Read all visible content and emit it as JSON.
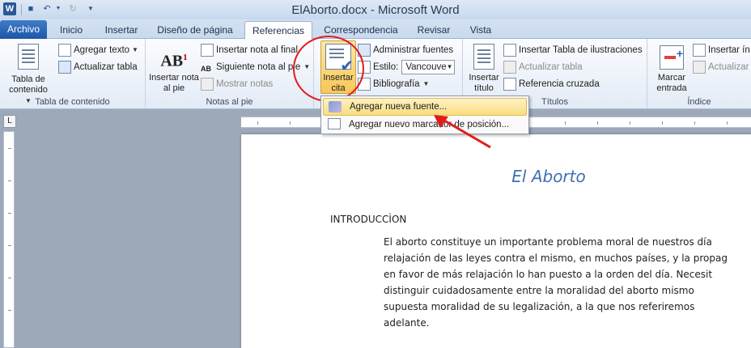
{
  "window": {
    "title": "ElAborto.docx  -  Microsoft Word"
  },
  "quick_access": {
    "word_icon": "W",
    "save_icon": "save-icon",
    "undo_icon": "undo-icon",
    "redo_icon": "redo-icon"
  },
  "tabs": [
    "Archivo",
    "Inicio",
    "Insertar",
    "Diseño de página",
    "Referencias",
    "Correspondencia",
    "Revisar",
    "Vista"
  ],
  "ribbon": {
    "toc_group": {
      "label": "Tabla de contenido",
      "toc_button": "Tabla de contenido",
      "add_text": "Agregar texto",
      "update_table": "Actualizar tabla"
    },
    "footnotes_group": {
      "label": "Notas al pie",
      "insert_footnote": "Insertar nota al pie",
      "insert_endnote": "Insertar nota al final",
      "next_footnote": "Siguiente nota al pie",
      "show_notes": "Mostrar notas"
    },
    "citations_group": {
      "insert_citation": "Insertar cita",
      "manage_sources": "Administrar fuentes",
      "style_label": "Estilo:",
      "style_value": "Vancouve",
      "bibliography": "Bibliografía"
    },
    "captions_group": {
      "label": "Títulos",
      "insert_caption": "Insertar título",
      "insert_table_of_figures": "Insertar Tabla de ilustraciones",
      "update_table": "Actualizar tabla",
      "cross_reference": "Referencia cruzada"
    },
    "index_group": {
      "label": "Índice",
      "mark_entry": "Marcar entrada",
      "insert_index": "Insertar ín",
      "update_index": "Actualizar"
    }
  },
  "menu": {
    "items": [
      "Agregar nueva fuente...",
      "Agregar nuevo marcador de posición..."
    ]
  },
  "document": {
    "title": "El Aborto",
    "heading": "INTRODUCCÌON",
    "lines": [
      "El aborto constituye un importante problema moral de nuestros día",
      "relajación de las leyes contra el mismo, en muchos países, y la propag",
      "en favor de más relajación lo han puesto a la orden del día. Necesit",
      "distinguir cuidadosamente entre la moralidad del aborto mismo",
      "supuesta moralidad de su legalización, a la que nos referiremos",
      "adelante."
    ]
  },
  "colors": {
    "accent": "#2b5797",
    "highlight": "#f8c758",
    "annotation": "#e31b1b",
    "doc_title": "#3f6fb1"
  }
}
